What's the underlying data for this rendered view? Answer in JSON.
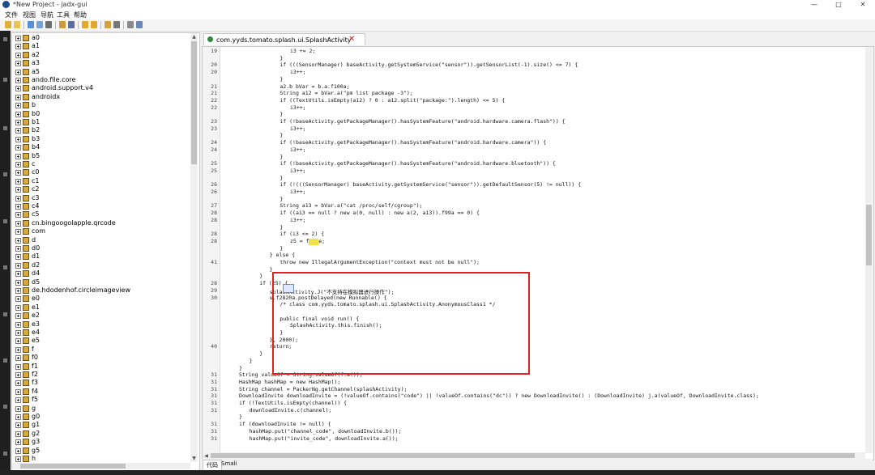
{
  "window": {
    "title": "*New Project - jadx-gui",
    "controls": {
      "minimize": "—",
      "maximize": "□",
      "close": "✕"
    }
  },
  "menu": [
    "文件",
    "视图",
    "导航",
    "工具",
    "帮助"
  ],
  "toolbar_icons": [
    "open-file-icon",
    "save-icon",
    "sync-icon",
    "save-all-icon",
    "export-icon",
    "tree-icon",
    "search-icon",
    "find-usage-icon",
    "back-icon",
    "forward-icon",
    "deobfuscation-icon",
    "log-icon",
    "preferences-icon"
  ],
  "tree": {
    "items": [
      "a0",
      "a1",
      "a2",
      "a3",
      "a5",
      "ando.file.core",
      "android.support.v4",
      "androidx",
      "b",
      "b0",
      "b1",
      "b2",
      "b3",
      "b4",
      "b5",
      "c",
      "c0",
      "c1",
      "c2",
      "c3",
      "c4",
      "c5",
      "cn.bingoogolapple.qrcode",
      "com",
      "d",
      "d0",
      "d1",
      "d2",
      "d4",
      "d5",
      "de.hdodenhof.circleimageview",
      "e0",
      "e1",
      "e2",
      "e3",
      "e4",
      "e5",
      "f",
      "f0",
      "f1",
      "f2",
      "f3",
      "f4",
      "f5",
      "g",
      "g0",
      "g1",
      "g2",
      "g3",
      "g5",
      "h"
    ]
  },
  "tab": {
    "title": "com.yyds.tomato.splash.ui.SplashActivity",
    "close": "✕"
  },
  "code_lines": [
    {
      "ln": "19",
      "indent": 20,
      "text": "i3 += 2;"
    },
    {
      "ln": "",
      "indent": 17,
      "text": "}"
    },
    {
      "ln": "20",
      "indent": 17,
      "text": "if (((SensorManager) baseActivity.getSystemService(\"sensor\")).getSensorList(-1).size() <= 7) {"
    },
    {
      "ln": "20",
      "indent": 20,
      "text": "i3++;"
    },
    {
      "ln": "",
      "indent": 17,
      "text": "}"
    },
    {
      "ln": "21",
      "indent": 17,
      "text": "a2.b bVar = b.a.f100a;"
    },
    {
      "ln": "21",
      "indent": 17,
      "text": "String a12 = bVar.a(\"pm list package -3\");"
    },
    {
      "ln": "22",
      "indent": 17,
      "text": "if ((TextUtils.isEmpty(a12) ? 0 : a12.split(\"package:\").length) <= 5) {"
    },
    {
      "ln": "22",
      "indent": 20,
      "text": "i3++;"
    },
    {
      "ln": "",
      "indent": 17,
      "text": "}"
    },
    {
      "ln": "23",
      "indent": 17,
      "text": "if (!baseActivity.getPackageManager().hasSystemFeature(\"android.hardware.camera.flash\")) {"
    },
    {
      "ln": "23",
      "indent": 20,
      "text": "i3++;"
    },
    {
      "ln": "",
      "indent": 17,
      "text": "}"
    },
    {
      "ln": "24",
      "indent": 17,
      "text": "if (!baseActivity.getPackageManager().hasSystemFeature(\"android.hardware.camera\")) {"
    },
    {
      "ln": "24",
      "indent": 20,
      "text": "i3++;"
    },
    {
      "ln": "",
      "indent": 17,
      "text": "}"
    },
    {
      "ln": "25",
      "indent": 17,
      "text": "if (!baseActivity.getPackageManager().hasSystemFeature(\"android.hardware.bluetooth\")) {"
    },
    {
      "ln": "25",
      "indent": 20,
      "text": "i3++;"
    },
    {
      "ln": "",
      "indent": 17,
      "text": "}"
    },
    {
      "ln": "26",
      "indent": 17,
      "text": "if (!(((SensorManager) baseActivity.getSystemService(\"sensor\")).getDefaultSensor(5) != null)) {"
    },
    {
      "ln": "26",
      "indent": 20,
      "text": "i3++;"
    },
    {
      "ln": "",
      "indent": 17,
      "text": "}"
    },
    {
      "ln": "27",
      "indent": 17,
      "text": "String a13 = bVar.a(\"cat /proc/self/cgroup\");"
    },
    {
      "ln": "28",
      "indent": 17,
      "text": "if ((a13 == null ? new a(0, null) : new a(2, a13)).f99a == 0) {"
    },
    {
      "ln": "28",
      "indent": 20,
      "text": "i3++;"
    },
    {
      "ln": "",
      "indent": 17,
      "text": "}"
    },
    {
      "ln": "28",
      "indent": 17,
      "text": "if (i3 <= 2) {"
    },
    {
      "ln": "28",
      "indent": 20,
      "text": "z5 = false;"
    },
    {
      "ln": "",
      "indent": 17,
      "text": "}"
    },
    {
      "ln": "",
      "indent": 14,
      "text": "} else {"
    },
    {
      "ln": "41",
      "indent": 17,
      "text": "throw new IllegalArgumentException(\"context must not be null\");"
    },
    {
      "ln": "",
      "indent": 14,
      "text": "}"
    },
    {
      "ln": "",
      "indent": 11,
      "text": "}"
    },
    {
      "ln": "28",
      "indent": 11,
      "text": "if (z5) {"
    },
    {
      "ln": "29",
      "indent": 14,
      "text": "splashActivity.J(\"不支持在模拟器进行操作\");"
    },
    {
      "ln": "30",
      "indent": 14,
      "text": "u.f2820a.postDelayed(new Runnable() {"
    },
    {
      "ln": "",
      "indent": 17,
      "text": "/* class com.yyds.tomato.splash.ui.SplashActivity.AnonymousClass1 */"
    },
    {
      "ln": "",
      "indent": 0,
      "text": ""
    },
    {
      "ln": "",
      "indent": 17,
      "text": "public final void run() {"
    },
    {
      "ln": "",
      "indent": 20,
      "text": "SplashActivity.this.finish();"
    },
    {
      "ln": "",
      "indent": 17,
      "text": "}"
    },
    {
      "ln": "",
      "indent": 14,
      "text": "}, 2000);"
    },
    {
      "ln": "40",
      "indent": 14,
      "text": "return;"
    },
    {
      "ln": "",
      "indent": 11,
      "text": "}"
    },
    {
      "ln": "",
      "indent": 8,
      "text": "}"
    },
    {
      "ln": "",
      "indent": 5,
      "text": "}"
    },
    {
      "ln": "31",
      "indent": 5,
      "text": "String valueOf = String.valueOf(f.a());"
    },
    {
      "ln": "31",
      "indent": 5,
      "text": "HashMap hashMap = new HashMap();"
    },
    {
      "ln": "31",
      "indent": 5,
      "text": "String channel = PackerNg.getChannel(splashActivity);"
    },
    {
      "ln": "31",
      "indent": 5,
      "text": "DownloadInvite downloadInvite = (!valueOf.contains(\"code\") || !valueOf.contains(\"dc\")) ? new DownloadInvite() : (DownloadInvite) j.a(valueOf, DownloadInvite.class);"
    },
    {
      "ln": "31",
      "indent": 5,
      "text": "if (!TextUtils.isEmpty(channel)) {"
    },
    {
      "ln": "31",
      "indent": 8,
      "text": "downloadInvite.c(channel);"
    },
    {
      "ln": "",
      "indent": 5,
      "text": "}"
    },
    {
      "ln": "31",
      "indent": 5,
      "text": "if (downloadInvite != null) {"
    },
    {
      "ln": "31",
      "indent": 8,
      "text": "hashMap.put(\"channel_code\", downloadInvite.b());"
    },
    {
      "ln": "31",
      "indent": 8,
      "text": "hashMap.put(\"invite_code\", downloadInvite.a());"
    }
  ],
  "bottom_tabs": [
    "代码",
    "Smali"
  ]
}
